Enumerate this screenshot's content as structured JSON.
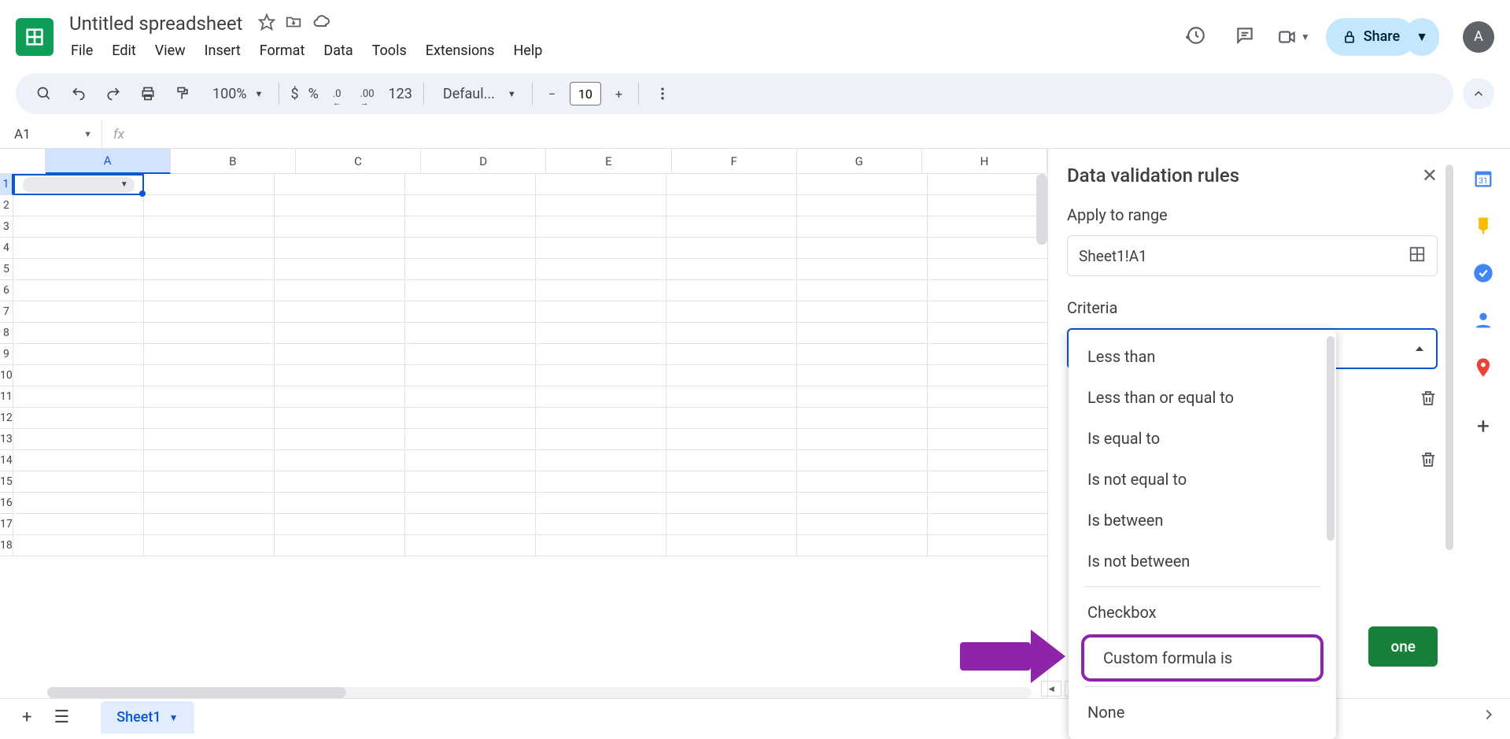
{
  "header": {
    "doc_title": "Untitled spreadsheet",
    "menus": [
      "File",
      "Edit",
      "View",
      "Insert",
      "Format",
      "Data",
      "Tools",
      "Extensions",
      "Help"
    ],
    "share_label": "Share",
    "avatar_letter": "A"
  },
  "toolbar": {
    "zoom": "100%",
    "currency": "$",
    "percent": "%",
    "dec_less": ".0",
    "dec_more": ".00",
    "num_123": "123",
    "font_name": "Defaul...",
    "font_size": "10"
  },
  "namebox": {
    "cell_ref": "A1",
    "fx_symbol": "fx"
  },
  "grid": {
    "columns": [
      "A",
      "B",
      "C",
      "D",
      "E",
      "F",
      "G",
      "H"
    ],
    "rows": [
      "1",
      "2",
      "3",
      "4",
      "5",
      "6",
      "7",
      "8",
      "9",
      "10",
      "11",
      "12",
      "13",
      "14",
      "15",
      "16",
      "17",
      "18"
    ],
    "active_col": "A",
    "active_row": "1"
  },
  "panel": {
    "title": "Data validation rules",
    "apply_label": "Apply to range",
    "range_value": "Sheet1!A1",
    "criteria_label": "Criteria",
    "done_label": "one",
    "dropdown_items": [
      "Less than",
      "Less than or equal to",
      "Is equal to",
      "Is not equal to",
      "Is between",
      "Is not between"
    ],
    "dropdown_checkbox": "Checkbox",
    "dropdown_highlighted": "Custom formula is",
    "dropdown_none": "None"
  },
  "sheets": {
    "tab1": "Sheet1"
  }
}
